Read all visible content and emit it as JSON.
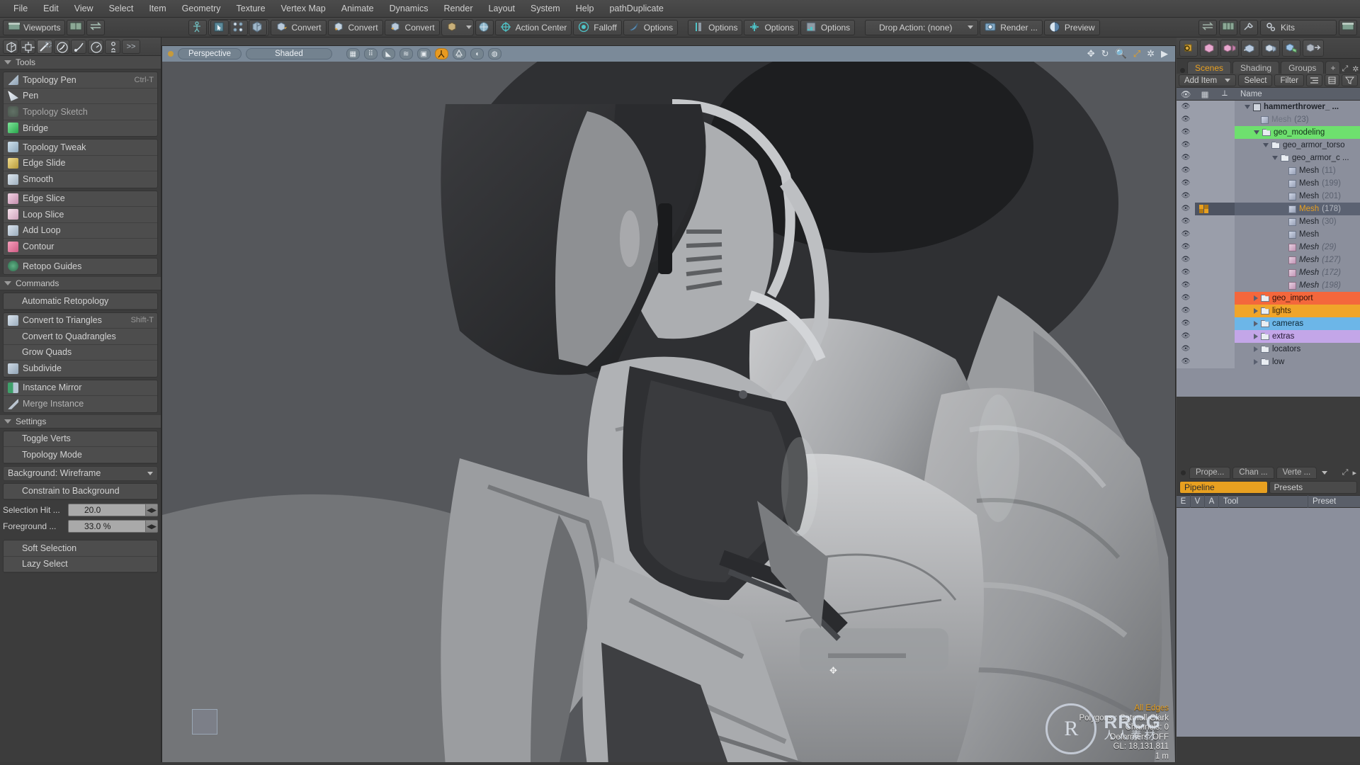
{
  "app": {
    "menu": [
      "File",
      "Edit",
      "View",
      "Select",
      "Item",
      "Geometry",
      "Texture",
      "Vertex Map",
      "Animate",
      "Dynamics",
      "Render",
      "Layout",
      "System",
      "Help",
      "pathDuplicate"
    ]
  },
  "toolbar": {
    "viewports_label": "Viewports",
    "convert_1": "Convert",
    "convert_2": "Convert",
    "convert_3": "Convert",
    "action_center": "Action Center",
    "falloff": "Falloff",
    "options_1": "Options",
    "options_2": "Options",
    "options_3": "Options",
    "options_4": "Options",
    "drop_action": "Drop Action: (none)",
    "render": "Render ...",
    "preview": "Preview",
    "kits": "Kits"
  },
  "left_panel": {
    "tools_section": "Tools",
    "tools": [
      {
        "label": "Topology Pen",
        "shortcut": "Ctrl-T",
        "icon": "topology-pen-icon",
        "color": "#9fb5c9"
      },
      {
        "label": "Pen",
        "shortcut": "",
        "icon": "pen-icon",
        "color": "#dfe6ee"
      },
      {
        "label": "Topology Sketch",
        "shortcut": "",
        "icon": "topology-sketch-icon",
        "color": "#6f8a76"
      },
      {
        "label": "Bridge",
        "shortcut": "",
        "icon": "bridge-icon",
        "color": "#4cc46a"
      }
    ],
    "tweak_tools": [
      {
        "label": "Topology Tweak",
        "icon": "topology-tweak-icon",
        "color": "#a8c4d6"
      },
      {
        "label": "Edge Slide",
        "icon": "edge-slide-icon",
        "color": "#d8c070"
      },
      {
        "label": "Smooth",
        "icon": "smooth-icon",
        "color": "#b9c6d4"
      }
    ],
    "slice_tools": [
      {
        "label": "Edge Slice",
        "icon": "edge-slice-icon",
        "color": "#e3b7cf"
      },
      {
        "label": "Loop Slice",
        "icon": "loop-slice-icon",
        "color": "#e8c4d4"
      },
      {
        "label": "Add Loop",
        "icon": "add-loop-icon",
        "color": "#b9c6d4"
      },
      {
        "label": "Contour",
        "icon": "contour-icon",
        "color": "#e07a9a"
      }
    ],
    "retopo_guides": {
      "label": "Retopo Guides",
      "icon": "retopo-guides-icon",
      "color": "#4e8f6a"
    },
    "commands_section": "Commands",
    "commands": [
      {
        "label": "Automatic Retopology",
        "icon": "",
        "shortcut": ""
      },
      {
        "label": "Convert to Triangles",
        "icon": "convert-triangles-icon",
        "shortcut": "Shift-T",
        "color": "#b9c6d4"
      },
      {
        "label": "Convert to Quadrangles",
        "icon": "",
        "shortcut": ""
      },
      {
        "label": "Grow Quads",
        "icon": "",
        "shortcut": ""
      },
      {
        "label": "Subdivide",
        "icon": "subdivide-icon",
        "shortcut": "",
        "color": "#a6b6c6"
      }
    ],
    "instance": [
      {
        "label": "Instance Mirror",
        "icon": "instance-mirror-icon",
        "color": "#4fa06a"
      },
      {
        "label": "Merge Instance",
        "icon": "merge-instance-icon",
        "color": "#cfd6de"
      }
    ],
    "settings_section": "Settings",
    "settings": [
      {
        "label": "Toggle Verts"
      },
      {
        "label": "Topology Mode"
      }
    ],
    "background_dropdown": "Background: Wireframe",
    "constrain_label": "Constrain to Background",
    "sliders": [
      {
        "label": "Selection Hit ...",
        "value": "20.0"
      },
      {
        "label": "Foreground  ...",
        "value": "33.0 %"
      }
    ],
    "footer_buttons": [
      "Soft Selection",
      "Lazy Select"
    ]
  },
  "viewport": {
    "projection": "Perspective",
    "shading": "Shaded",
    "icons": [
      "checker-icon",
      "grid-icon",
      "wireframe-icon",
      "curves-icon",
      "frame-icon",
      "figure-icon",
      "light-icon",
      "camera-icon",
      "backdrop-icon"
    ],
    "nav_icons": [
      "pan-icon",
      "rotate-icon",
      "zoom-icon",
      "fit-icon",
      "gear-icon",
      "chevron-right-icon"
    ],
    "stats": {
      "all_edges": "All Edges",
      "polygons": "Polygons : Catmull-Clark",
      "channels": "Channels: 0",
      "deformers": "Deformers: OFF",
      "gl": "GL: 18,131,811",
      "unit": "1 m"
    }
  },
  "right_panel": {
    "tabs": [
      {
        "label": "Scenes",
        "active": true
      },
      {
        "label": "Shading",
        "active": false
      },
      {
        "label": "Groups",
        "active": false
      },
      {
        "label": "+",
        "active": false
      }
    ],
    "filterbar": [
      "Add Item",
      "Select",
      "Filter"
    ],
    "tree_headers": {
      "eye": "eye-icon",
      "c2": "lock-icon",
      "c3": "axis-icon",
      "name": "Name"
    },
    "tree": [
      {
        "label": "hammerthrower_ ...",
        "count": "",
        "depth": 0,
        "type": "scene",
        "state": "open",
        "bold": true
      },
      {
        "label": "Mesh",
        "count": "(23)",
        "depth": 1,
        "type": "mesh",
        "dim": true
      },
      {
        "label": "geo_modeling",
        "count": "",
        "depth": 1,
        "type": "folder",
        "state": "open",
        "highlight": "#6ee06e",
        "textcolor": "#14301a"
      },
      {
        "label": "geo_armor_torso",
        "count": "",
        "depth": 2,
        "type": "folder",
        "state": "open"
      },
      {
        "label": "geo_armor_c ...",
        "count": "",
        "depth": 3,
        "type": "folder",
        "state": "open"
      },
      {
        "label": "Mesh",
        "count": "(11)",
        "depth": 4,
        "type": "mesh"
      },
      {
        "label": "Mesh",
        "count": "(199)",
        "depth": 4,
        "type": "mesh"
      },
      {
        "label": "Mesh",
        "count": "(201)",
        "depth": 4,
        "type": "mesh"
      },
      {
        "label": "Mesh",
        "count": "(178)",
        "depth": 4,
        "type": "mesh",
        "selected": true
      },
      {
        "label": "Mesh",
        "count": "(30)",
        "depth": 4,
        "type": "mesh"
      },
      {
        "label": "Mesh",
        "count": "",
        "depth": 4,
        "type": "mesh"
      },
      {
        "label": "Mesh",
        "count": "(29)",
        "depth": 4,
        "type": "mesh",
        "italic": true,
        "pink": true
      },
      {
        "label": "Mesh",
        "count": "(127)",
        "depth": 4,
        "type": "mesh",
        "italic": true,
        "pink": true
      },
      {
        "label": "Mesh",
        "count": "(172)",
        "depth": 4,
        "type": "mesh",
        "italic": true,
        "pink": true
      },
      {
        "label": "Mesh",
        "count": "(198)",
        "depth": 4,
        "type": "mesh",
        "italic": true,
        "pink": true
      },
      {
        "label": "geo_import",
        "count": "",
        "depth": 1,
        "type": "folder",
        "state": "closed",
        "highlight": "#f4673c",
        "textcolor": "#2b1008"
      },
      {
        "label": "lights",
        "count": "",
        "depth": 1,
        "type": "folder",
        "state": "closed",
        "highlight": "#f0a52a",
        "textcolor": "#33210a"
      },
      {
        "label": "cameras",
        "count": "",
        "depth": 1,
        "type": "folder",
        "state": "closed",
        "highlight": "#6cb6e8",
        "textcolor": "#0d2634"
      },
      {
        "label": "extras",
        "count": "",
        "depth": 1,
        "type": "folder",
        "state": "closed",
        "highlight": "#c3a6e8",
        "textcolor": "#241833"
      },
      {
        "label": "locators",
        "count": "",
        "depth": 1,
        "type": "folder",
        "state": "closed",
        "highlight": "#8b8f9c",
        "textcolor": "#1d2029"
      },
      {
        "label": "low",
        "count": "",
        "depth": 1,
        "type": "folder",
        "state": "closed"
      }
    ],
    "bottom_tabs": [
      "Prope...",
      "Chan ...",
      "Verte ..."
    ],
    "pipeline_tabs": [
      {
        "label": "Pipeline",
        "active": true
      },
      {
        "label": "Presets",
        "active": false
      }
    ],
    "list_columns": [
      "E",
      "V",
      "A",
      "Tool",
      "Preset"
    ]
  },
  "watermark": {
    "logo_glyph": "R",
    "line1": "RRCG",
    "line2": "人人素材"
  },
  "colors": {
    "accent": "#e8a020",
    "panel": "#3c3c3c",
    "viewport_header": "#7b8a99",
    "tree_bg": "#8b8f9c",
    "green": "#6ee06e",
    "orange_red": "#f4673c"
  }
}
